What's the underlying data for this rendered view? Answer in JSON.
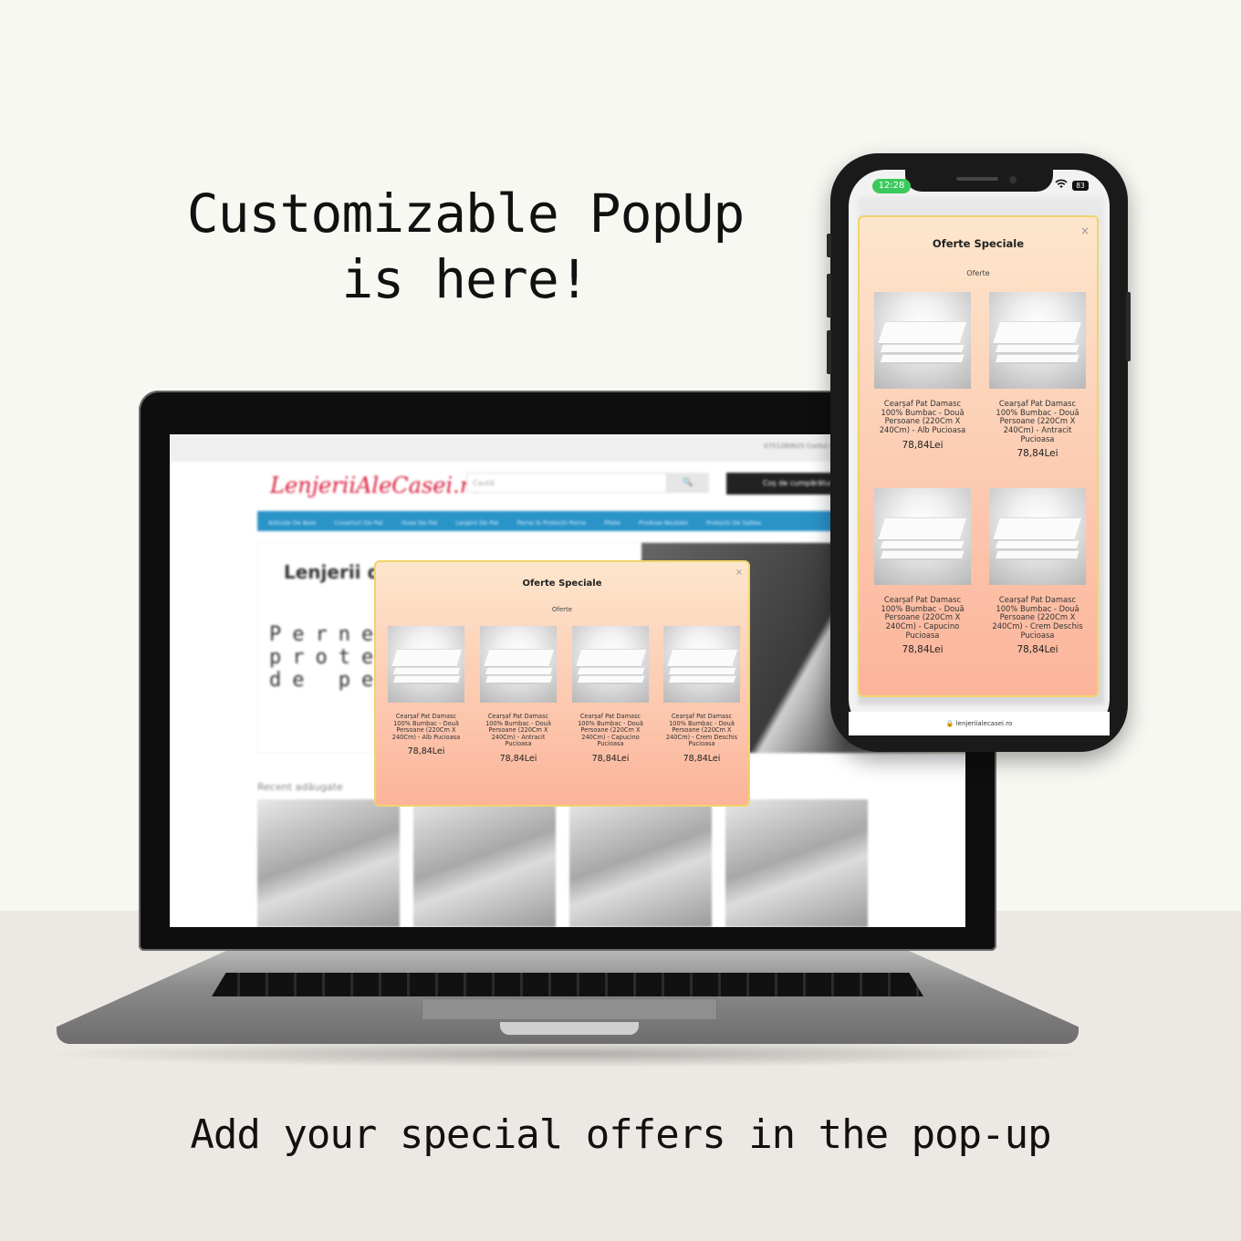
{
  "headline": {
    "line1": "Customizable PopUp",
    "line2": "is here!"
  },
  "caption": "Add your special offers in the pop-up",
  "laptop_site": {
    "topbar_text": "0751280625   Contul meu   Favorite (0)   Coș de cumpărături",
    "logo": "LenjeriiAleCasei.ro",
    "search_placeholder": "Caută",
    "search_button": "🔍",
    "cart_label": "Coș de cumpărături - 0,00 Lei",
    "nav_items": [
      "Articole De Baie",
      "Cuverturi De Pat",
      "Huse De Pat",
      "Lenjerii De Pat",
      "Perne Si Protectii Perna",
      "Pilote",
      "Produse Noutate",
      "Protectii De Saltea"
    ],
    "banner_title": "Lenjerii de",
    "banner_sub": "Perne protecții de pe",
    "recent_title": "Recent adăugate"
  },
  "popup": {
    "title": "Oferte Speciale",
    "subtitle": "Oferte",
    "close": "×",
    "products": [
      {
        "name": "Cearșaf Pat Damasc 100% Bumbac - Două Persoane (220Cm X 240Cm) - Alb Pucioasa",
        "price": "78,84Lei"
      },
      {
        "name": "Cearșaf Pat Damasc 100% Bumbac - Două Persoane (220Cm X 240Cm) - Antracit Pucioasa",
        "price": "78,84Lei"
      },
      {
        "name": "Cearșaf Pat Damasc 100% Bumbac - Două Persoane (220Cm X 240Cm) - Capucino Pucioasa",
        "price": "78,84Lei"
      },
      {
        "name": "Cearșaf Pat Damasc 100% Bumbac - Două Persoane (220Cm X 240Cm) - Crem Deschis Pucioasa",
        "price": "78,84Lei"
      }
    ]
  },
  "phone": {
    "time": "12:28",
    "battery": "83",
    "url": "🔒 lenjeriialecasei.ro"
  }
}
